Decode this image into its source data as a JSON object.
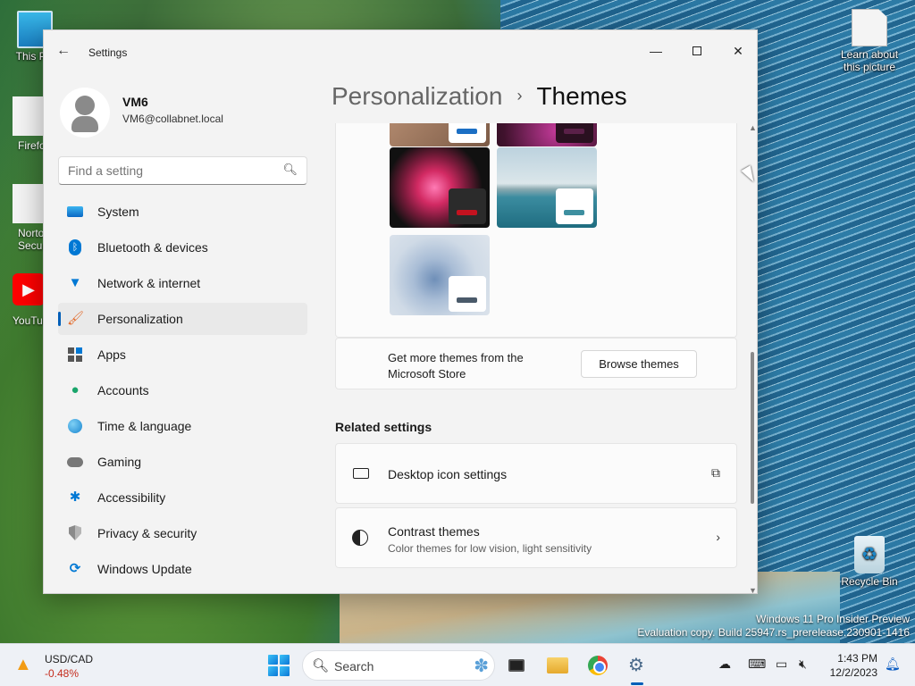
{
  "desktop": {
    "icons": [
      {
        "label": "This PC"
      },
      {
        "label": "Firefox"
      },
      {
        "label": "Norton Security"
      },
      {
        "label": "YouTube"
      },
      {
        "label": "Learn about this picture"
      },
      {
        "label": "Recycle Bin"
      }
    ],
    "watermark_line1": "Windows 11 Pro Insider Preview",
    "watermark_line2": "Evaluation copy. Build 25947.rs_prerelease.230901-1416"
  },
  "window": {
    "app_title": "Settings",
    "back_glyph": "←",
    "minimize_glyph": "—",
    "close_glyph": "✕"
  },
  "user": {
    "name": "VM6",
    "email": "VM6@collabnet.local"
  },
  "search": {
    "placeholder": "Find a setting",
    "icon": "search-icon"
  },
  "nav": {
    "items": [
      {
        "label": "System",
        "icon": "system-icon",
        "active": false,
        "color": "#0078d4"
      },
      {
        "label": "Bluetooth & devices",
        "icon": "bluetooth-icon",
        "active": false,
        "color": "#0078d4"
      },
      {
        "label": "Network & internet",
        "icon": "wifi-icon",
        "active": false,
        "color": "#0078d4"
      },
      {
        "label": "Personalization",
        "icon": "brush-icon",
        "active": true,
        "color": "#e36b2c"
      },
      {
        "label": "Apps",
        "icon": "apps-icon",
        "active": false,
        "color": "#505050"
      },
      {
        "label": "Accounts",
        "icon": "accounts-icon",
        "active": false,
        "color": "#1aa56b"
      },
      {
        "label": "Time & language",
        "icon": "globe-icon",
        "active": false,
        "color": "#0078d4"
      },
      {
        "label": "Gaming",
        "icon": "gamepad-icon",
        "active": false,
        "color": "#6b6b6b"
      },
      {
        "label": "Accessibility",
        "icon": "accessibility-icon",
        "active": false,
        "color": "#0078d4"
      },
      {
        "label": "Privacy & security",
        "icon": "shield-icon",
        "active": false,
        "color": "#6b6b6b"
      },
      {
        "label": "Windows Update",
        "icon": "update-icon",
        "active": false,
        "color": "#0078d4"
      }
    ]
  },
  "breadcrumb": {
    "parent": "Personalization",
    "separator": "›",
    "current": "Themes"
  },
  "themes": {
    "chip_colors": [
      "#1b6fc4",
      "#5a2048",
      "#c4121f",
      "#3d8fa0",
      "#4a5a6a"
    ]
  },
  "store": {
    "text": "Get more themes from the Microsoft Store",
    "button": "Browse themes"
  },
  "related": {
    "heading": "Related settings",
    "rows": [
      {
        "title": "Desktop icon settings",
        "subtitle": "",
        "icon": "monitor-icon",
        "action": "external-link-icon"
      },
      {
        "title": "Contrast themes",
        "subtitle": "Color themes for low vision, light sensitivity",
        "icon": "contrast-icon",
        "action": "chevron-right-icon"
      }
    ]
  },
  "taskbar": {
    "widget_title": "USD/CAD",
    "widget_value": "-0.48%",
    "search_label": "Search",
    "time": "1:43 PM",
    "date": "12/2/2023",
    "accent": "#005fb8"
  }
}
